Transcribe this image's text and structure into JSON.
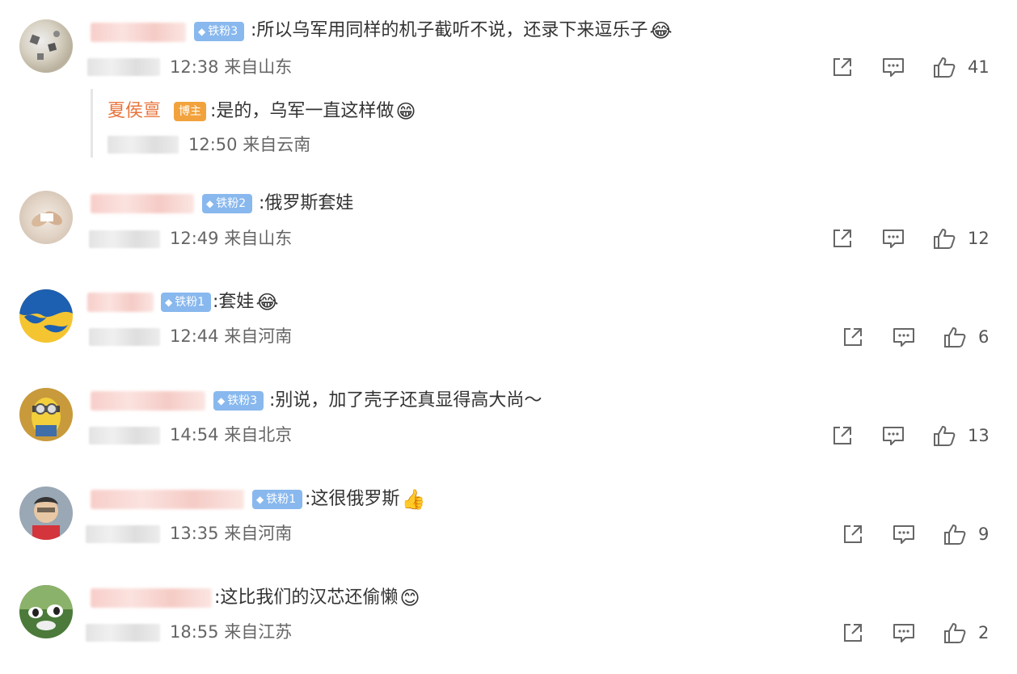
{
  "comments": [
    {
      "text": "所以乌军用同样的机子截听不说，还录下来逗乐子",
      "emoji": "😂",
      "time": "12:38",
      "location": "来自山东",
      "likes": "41",
      "badge": "铁粉3",
      "reply": {
        "author": "夏侯亶",
        "tag": "博主",
        "text": "是的，乌军一直这样做",
        "emoji": "😁",
        "time": "12:50",
        "location": "来自云南"
      }
    },
    {
      "text": "俄罗斯套娃",
      "time": "12:49",
      "location": "来自山东",
      "likes": "12",
      "badge": "铁粉2"
    },
    {
      "text": "套娃",
      "emoji": "😂",
      "time": "12:44",
      "location": "来自河南",
      "likes": "6",
      "badge": "铁粉1"
    },
    {
      "text": "别说，加了壳子还真显得高大尚～",
      "time": "14:54",
      "location": "来自北京",
      "likes": "13",
      "badge": "铁粉3"
    },
    {
      "text": "这很俄罗斯",
      "emoji": "👍",
      "time": "13:35",
      "location": "来自河南",
      "likes": "9",
      "badge": "铁粉1"
    },
    {
      "text": "这比我们的汉芯还偷懒",
      "emoji": "😊",
      "time": "18:55",
      "location": "来自江苏",
      "likes": "2"
    }
  ],
  "icons": {
    "share": "share-icon",
    "comment": "comment-icon",
    "like": "thumbs-up-icon"
  },
  "colors": {
    "badge_fan": "#88b8ee",
    "badge_host": "#f2a23c",
    "reply_author": "#e8743b"
  }
}
